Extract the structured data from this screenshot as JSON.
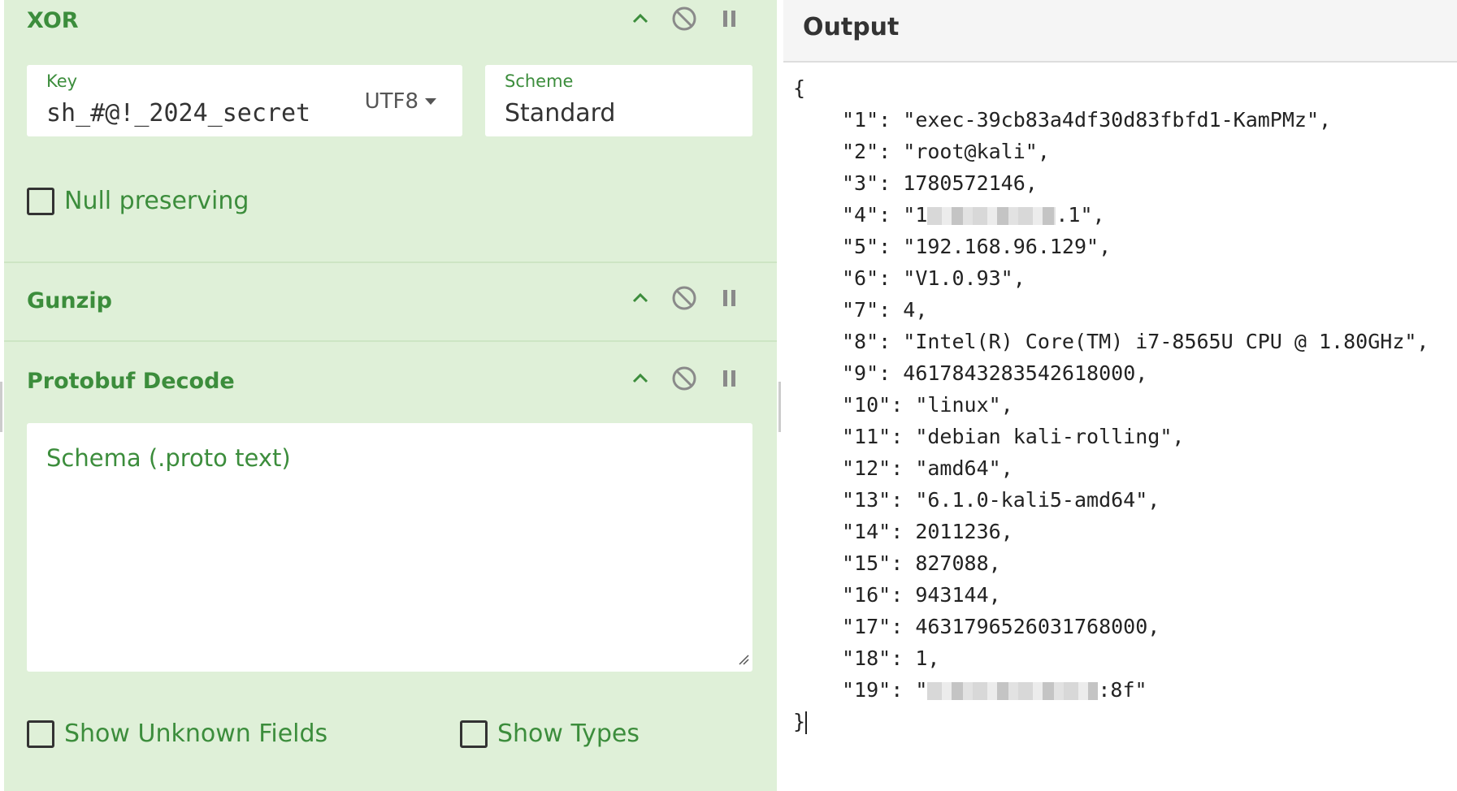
{
  "recipe": {
    "xor": {
      "title": "XOR",
      "key_label": "Key",
      "key_value": "sh_#@!_2024_secret",
      "key_encoding": "UTF8",
      "scheme_label": "Scheme",
      "scheme_value": "Standard",
      "null_preserving_label": "Null preserving",
      "null_preserving_checked": false
    },
    "gunzip": {
      "title": "Gunzip"
    },
    "protobuf": {
      "title": "Protobuf Decode",
      "schema_placeholder": "Schema (.proto text)",
      "show_unknown_label": "Show Unknown Fields",
      "show_unknown_checked": false,
      "show_types_label": "Show Types",
      "show_types_checked": false
    },
    "icons": {
      "collapse": "chevron-up-icon",
      "disable": "disable-icon",
      "breakpoint": "pause-icon"
    },
    "colors": {
      "op_bg": "#dff0d8",
      "op_text": "#3c8d3c"
    }
  },
  "output": {
    "title": "Output",
    "open_brace": "{",
    "close_brace": "}",
    "lines": [
      {
        "key": "\"1\": ",
        "val": "\"exec-39cb83a4df30d83fbfd1-KamPMz\","
      },
      {
        "key": "\"2\": ",
        "val": "\"root@kali\","
      },
      {
        "key": "\"3\": ",
        "val": "1780572146,"
      },
      {
        "key": "\"4\": ",
        "val_pre": "\"1",
        "val_post": ".1\","
      },
      {
        "key": "\"5\": ",
        "val": "\"192.168.96.129\","
      },
      {
        "key": "\"6\": ",
        "val": "\"V1.0.93\","
      },
      {
        "key": "\"7\": ",
        "val": "4,"
      },
      {
        "key": "\"8\": ",
        "val": "\"Intel(R) Core(TM) i7-8565U CPU @ 1.80GHz\","
      },
      {
        "key": "\"9\": ",
        "val": "4617843283542618000,"
      },
      {
        "key": "\"10\": ",
        "val": "\"linux\","
      },
      {
        "key": "\"11\": ",
        "val": "\"debian kali-rolling\","
      },
      {
        "key": "\"12\": ",
        "val": "\"amd64\","
      },
      {
        "key": "\"13\": ",
        "val": "\"6.1.0-kali5-amd64\","
      },
      {
        "key": "\"14\": ",
        "val": "2011236,"
      },
      {
        "key": "\"15\": ",
        "val": "827088,"
      },
      {
        "key": "\"16\": ",
        "val": "943144,"
      },
      {
        "key": "\"17\": ",
        "val": "4631796526031768000,"
      },
      {
        "key": "\"18\": ",
        "val": "1,"
      },
      {
        "key": "\"19\": ",
        "val_pre": "\"",
        "val_post": ":8f\""
      }
    ]
  }
}
